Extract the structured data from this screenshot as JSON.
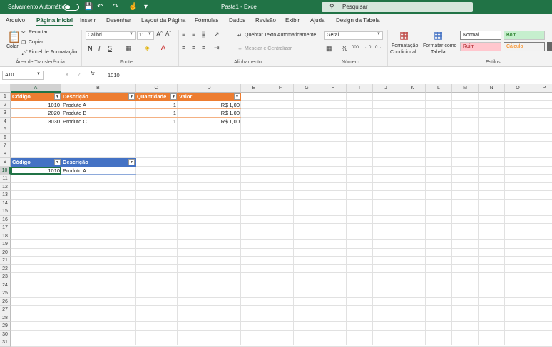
{
  "window": {
    "autosave_label": "Salvamento Automático",
    "title": "Pasta1 - Excel",
    "search_placeholder": "Pesquisar"
  },
  "tabs": [
    "Arquivo",
    "Página Inicial",
    "Inserir",
    "Desenhar",
    "Layout da Página",
    "Fórmulas",
    "Dados",
    "Revisão",
    "Exibir",
    "Ajuda",
    "Design da Tabela"
  ],
  "active_tab": "Página Inicial",
  "ribbon": {
    "clipboard": {
      "paste": "Colar",
      "cut": "Recortar",
      "copy": "Copiar",
      "format_painter": "Pincel de Formatação",
      "group": "Área de Transferência"
    },
    "font": {
      "name": "Calibri",
      "size": "11",
      "group": "Fonte",
      "bold": "N",
      "italic": "I",
      "underline": "S"
    },
    "alignment": {
      "wrap": "Quebrar Texto Automaticamente",
      "merge": "Mesclar e Centralizar",
      "group": "Alinhamento"
    },
    "number": {
      "format": "Geral",
      "group": "Número",
      "percent": "%"
    },
    "styles": {
      "conditional_line1": "Formatação",
      "conditional_line2": "Condicional",
      "table_line1": "Formatar como",
      "table_line2": "Tabela",
      "normal": "Normal",
      "good": "Bom",
      "bad": "Ruim",
      "calc": "Cálculo",
      "group": "Estilos"
    }
  },
  "formula_bar": {
    "name_box": "A10",
    "value": "1010",
    "fx": "fx"
  },
  "columns": [
    "A",
    "B",
    "C",
    "D",
    "E",
    "F",
    "G",
    "H",
    "I",
    "J",
    "K",
    "L",
    "M",
    "N",
    "O",
    "P"
  ],
  "rows": [
    "1",
    "2",
    "3",
    "4",
    "5",
    "6",
    "7",
    "8",
    "9",
    "10",
    "11",
    "12",
    "13",
    "14",
    "15",
    "16",
    "17",
    "18",
    "19",
    "20",
    "21",
    "22",
    "23",
    "24",
    "25",
    "26",
    "27",
    "28",
    "29",
    "30",
    "31"
  ],
  "table1": {
    "headers": [
      "Código",
      "Descrição",
      "Quantidade",
      "Valor"
    ],
    "rows": [
      [
        "1010",
        "Produto A",
        "1",
        "R$ 1,00"
      ],
      [
        "2020",
        "Produto B",
        "1",
        "R$ 1,00"
      ],
      [
        "3030",
        "Produto C",
        "1",
        "R$ 1,00"
      ]
    ]
  },
  "table2": {
    "headers": [
      "Código",
      "Descrição"
    ],
    "rows": [
      [
        "1010",
        "Produto A"
      ]
    ]
  },
  "colors": {
    "excel_green": "#217346",
    "table1_header": "#ed7d31",
    "table2_header": "#4472c4"
  }
}
